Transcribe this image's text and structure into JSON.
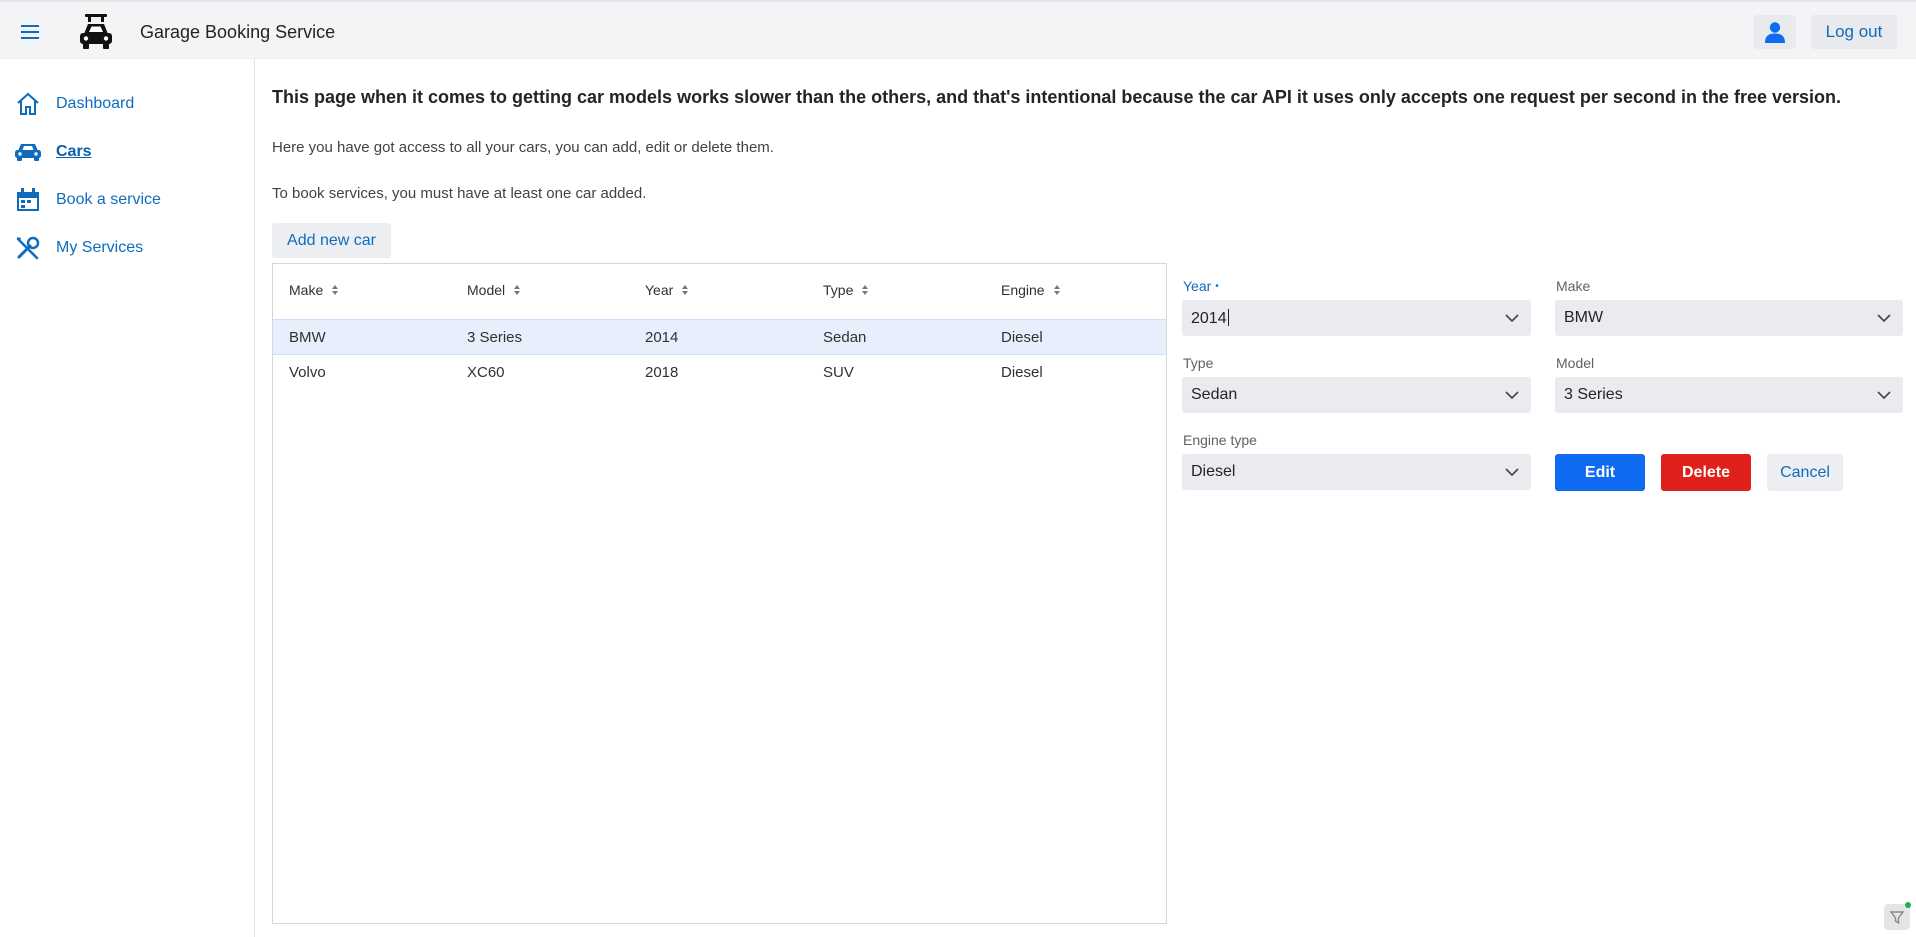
{
  "header": {
    "title": "Garage Booking Service",
    "logout_label": "Log out"
  },
  "sidebar": {
    "items": [
      {
        "label": "Dashboard",
        "icon": "home-icon"
      },
      {
        "label": "Cars",
        "icon": "car-icon",
        "active": true
      },
      {
        "label": "Book a service",
        "icon": "calendar-icon"
      },
      {
        "label": "My Services",
        "icon": "tools-icon"
      }
    ]
  },
  "main": {
    "notice": "This page when it comes to getting car models works slower than the others, and that's intentional because the car API it uses only accepts one request per second in the free version.",
    "intro": "Here you have got access to all your cars, you can add, edit or delete them.",
    "requirement": "To book services, you must have at least one car added.",
    "add_button": "Add new car"
  },
  "table": {
    "columns": [
      "Make",
      "Model",
      "Year",
      "Type",
      "Engine"
    ],
    "rows": [
      {
        "make": "BMW",
        "model": "3 Series",
        "year": "2014",
        "type": "Sedan",
        "engine": "Diesel",
        "selected": true
      },
      {
        "make": "Volvo",
        "model": "XC60",
        "year": "2018",
        "type": "SUV",
        "engine": "Diesel"
      }
    ]
  },
  "form": {
    "year": {
      "label": "Year",
      "required_mark": "•",
      "value": "2014"
    },
    "make": {
      "label": "Make",
      "value": "BMW"
    },
    "type": {
      "label": "Type",
      "value": "Sedan"
    },
    "model": {
      "label": "Model",
      "value": "3 Series"
    },
    "engine": {
      "label": "Engine type",
      "value": "Diesel"
    },
    "edit_label": "Edit",
    "delete_label": "Delete",
    "cancel_label": "Cancel"
  },
  "colors": {
    "primary": "#0f6cf2",
    "danger": "#e0201a",
    "link": "#0f6cbd",
    "selected_row": "#e6effb"
  }
}
